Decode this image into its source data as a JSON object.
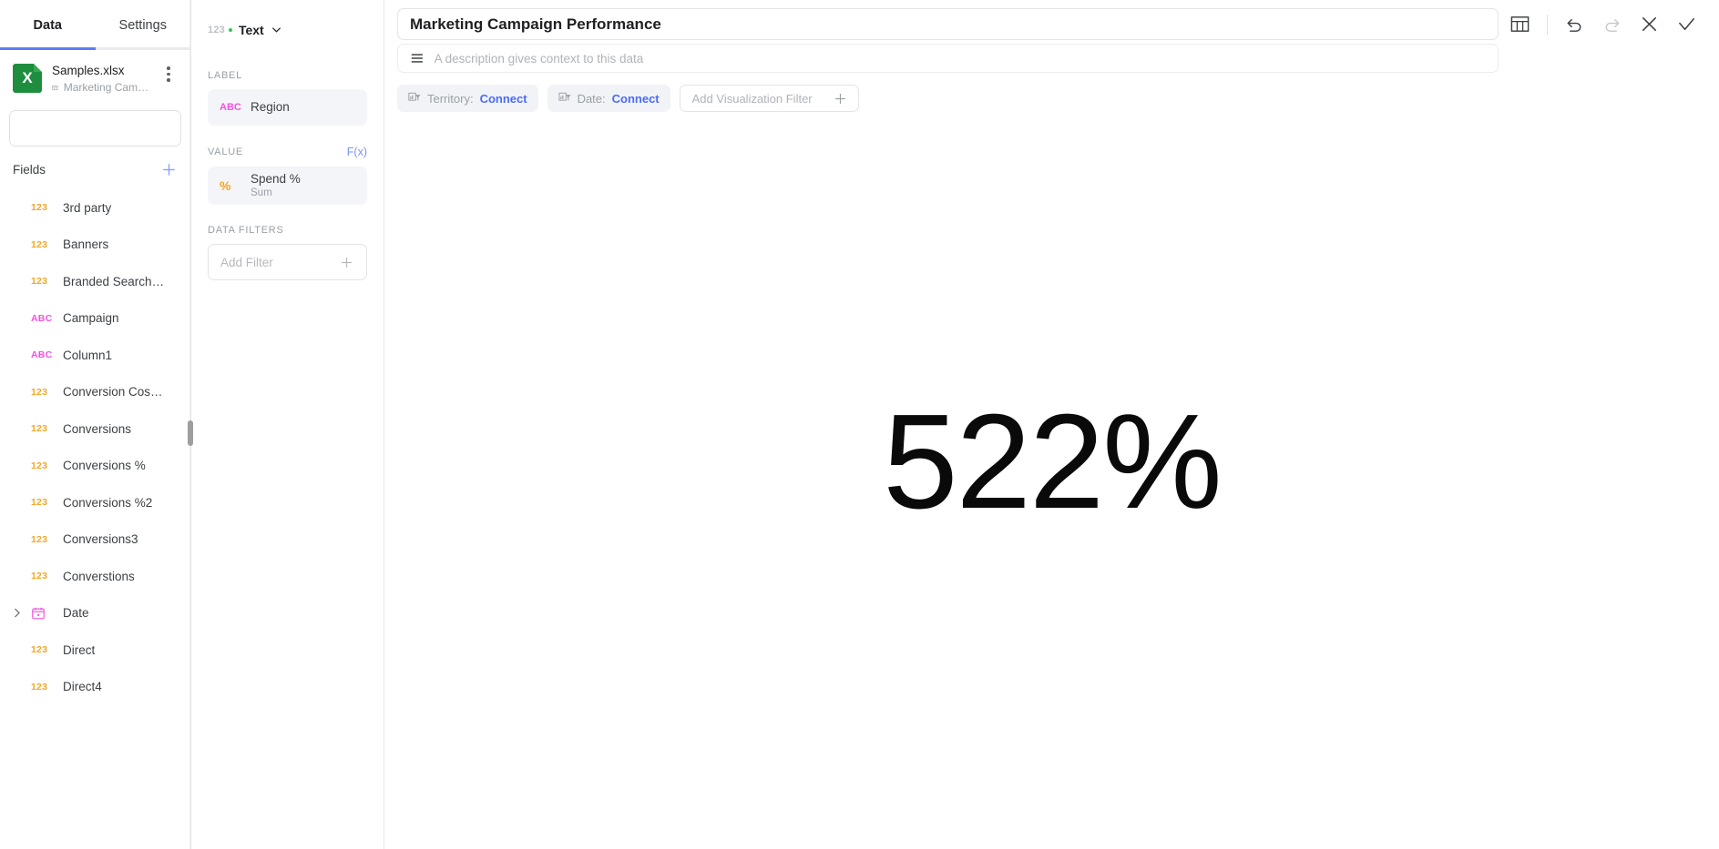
{
  "sidebar": {
    "tabs": [
      {
        "label": "Data",
        "active": true
      },
      {
        "label": "Settings",
        "active": false
      }
    ],
    "file": {
      "name": "Samples.xlsx",
      "sheet": "Marketing Campaign Performance",
      "icon_letter": "X"
    },
    "search": {
      "value": "",
      "placeholder": ""
    },
    "fields_header": "Fields",
    "fields": [
      {
        "type": "123",
        "label": "3rd party"
      },
      {
        "type": "123",
        "label": "Banners"
      },
      {
        "type": "123",
        "label": "Branded Search…"
      },
      {
        "type": "ABC",
        "label": "Campaign"
      },
      {
        "type": "ABC",
        "label": "Column1"
      },
      {
        "type": "123",
        "label": "Conversion Cos…"
      },
      {
        "type": "123",
        "label": "Conversions"
      },
      {
        "type": "123",
        "label": "Conversions %"
      },
      {
        "type": "123",
        "label": "Conversions %2"
      },
      {
        "type": "123",
        "label": "Conversions3"
      },
      {
        "type": "123",
        "label": "Converstions"
      },
      {
        "type": "DATE",
        "label": "Date",
        "expandable": true
      },
      {
        "type": "123",
        "label": "Direct"
      },
      {
        "type": "123",
        "label": "Direct4"
      }
    ]
  },
  "config": {
    "viz_type_badge": "123",
    "viz_type_label": "Text",
    "label_section": "LABEL",
    "label_chip": {
      "icon": "ABC",
      "title": "Region"
    },
    "value_section": "VALUE",
    "value_fx": "F(x)",
    "value_chip": {
      "icon": "%",
      "title": "Spend %",
      "sub": "Sum"
    },
    "filters_section": "DATA FILTERS",
    "add_filter_label": "Add Filter"
  },
  "main": {
    "title": "Marketing Campaign Performance",
    "description_value": "",
    "description_placeholder": "A description gives context to this data",
    "filters": [
      {
        "label": "Territory:",
        "link": "Connect"
      },
      {
        "label": "Date:",
        "link": "Connect"
      }
    ],
    "add_visualization_filter": "Add Visualization Filter",
    "toolbar_icons": [
      "table-icon",
      "undo-icon",
      "redo-icon",
      "close-icon",
      "confirm-icon"
    ]
  },
  "chart_data": {
    "type": "table",
    "title": "Marketing Campaign Performance",
    "label_field": "Region",
    "value_field": "Spend %",
    "aggregation": "Sum",
    "display_value": "522%",
    "values": [
      522
    ],
    "categories": [
      "Region"
    ],
    "xlabel": "",
    "ylabel": "Spend %"
  },
  "colors": {
    "accent_blue": "#4a6cf7",
    "tab_underline": "#5b7cfa",
    "number_type": "#f5a623",
    "text_type": "#f452e0",
    "excel_green": "#1e8e3e",
    "status_dot": "#34c759"
  }
}
